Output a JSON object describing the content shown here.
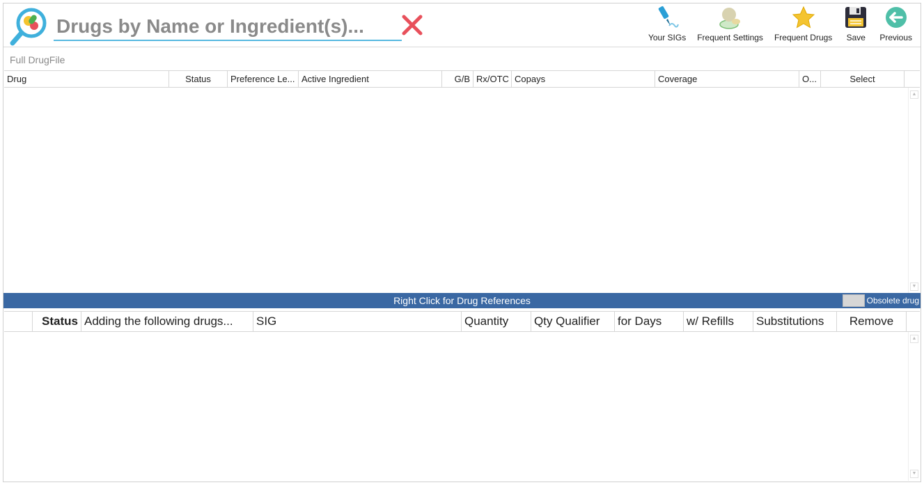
{
  "search": {
    "placeholder": "Drugs by Name or Ingredient(s)..."
  },
  "toolbar": {
    "your_sigs": "Your SIGs",
    "frequent_settings": "Frequent Settings",
    "frequent_drugs": "Frequent Drugs",
    "save": "Save",
    "previous": "Previous"
  },
  "drug_grid": {
    "title": "Full DrugFile",
    "columns": [
      "Drug",
      "Status",
      "Preference Le...",
      "Active Ingredient",
      "G/B",
      "Rx/OTC",
      "Copays",
      "Coverage",
      "O...",
      "Select"
    ]
  },
  "status_bar": {
    "message": "Right Click for Drug References",
    "obsolete_label": "Obsolete drug"
  },
  "add_grid": {
    "columns": [
      "Status",
      "Adding the following drugs...",
      "SIG",
      "Quantity",
      "Qty Qualifier",
      "for Days",
      "w/ Refills",
      "Substitutions",
      "Remove"
    ]
  },
  "colors": {
    "accent_blue": "#3a68a3",
    "search_underline": "#55b8e0",
    "clear_red": "#e8505b",
    "star_yellow": "#f4c430"
  }
}
